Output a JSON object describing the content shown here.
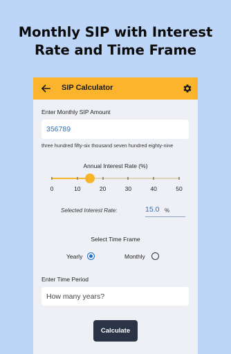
{
  "promo": {
    "line1": "Monthly SIP with Interest",
    "line2": "Rate and Time Frame"
  },
  "appbar": {
    "title": "SIP Calculator",
    "back_icon": "arrow-left",
    "settings_icon": "gear",
    "color": "#fbb42b"
  },
  "sip": {
    "label": "Enter Monthly SIP Amount",
    "value": "356789",
    "words": "three hundred fifty-six thousand seven hundred eighty-nine"
  },
  "rate": {
    "label": "Annual Interest Rate (%)",
    "slider_value": 15.0,
    "slider_min": 0,
    "slider_max": 50,
    "ticks": [
      "0",
      "10",
      "20",
      "30",
      "40",
      "50"
    ],
    "selected_label": "Selected Interest Rate:",
    "selected_value": "15.0",
    "unit": "%"
  },
  "time_frame": {
    "label": "Select Time Frame",
    "options": [
      {
        "label": "Yearly",
        "selected": true
      },
      {
        "label": "Monthly",
        "selected": false
      }
    ]
  },
  "period": {
    "label": "Enter Time Period",
    "placeholder": "How many years?"
  },
  "calculate_label": "Calculate",
  "colors": {
    "background": "#bdd6f7",
    "accent": "#fbb42b",
    "button": "#2b3447",
    "value_text": "#2a6fb8"
  }
}
